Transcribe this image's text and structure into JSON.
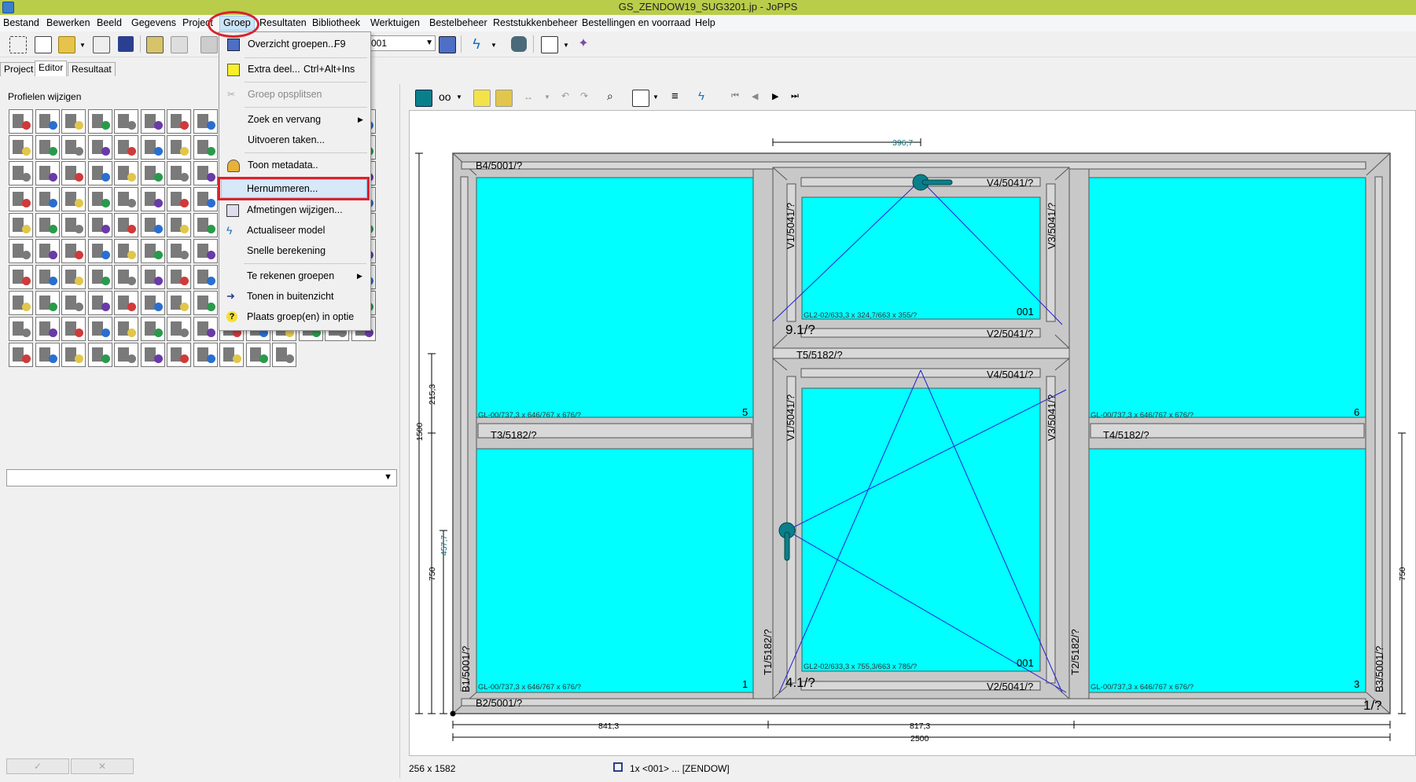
{
  "window": {
    "title": "GS_ZENDOW19_SUG3201.jp - JoPPS"
  },
  "menubar": [
    "Bestand",
    "Bewerken",
    "Beeld",
    "Gegevens",
    "Project",
    "Groep",
    "Resultaten",
    "Bibliotheek",
    "Werktuigen",
    "Bestelbeheer",
    "Reststukkenbeheer",
    "Bestellingen en voorraad",
    "Help"
  ],
  "toolbar": {
    "combo_value": "001"
  },
  "tabs": [
    "Project",
    "Editor",
    "Resultaat"
  ],
  "left_panel": {
    "title": "Profielen wijzigen"
  },
  "groep_menu": {
    "items": [
      {
        "label": "Overzicht groepen...",
        "accel": "F9",
        "icon": "list-icon"
      },
      {
        "label": "Extra deel...",
        "accel": "Ctrl+Alt+Ins",
        "icon": "yellow-square-icon"
      },
      {
        "label": "Groep opsplitsen",
        "icon": "split-icon",
        "disabled": true
      },
      {
        "label": "Zoek en vervang",
        "submenu": true
      },
      {
        "label": "Uitvoeren taken..."
      },
      {
        "label": "Toon metadata..",
        "icon": "person-icon"
      },
      {
        "label": "Hernummeren...",
        "highlighted": true
      },
      {
        "label": "Afmetingen wijzigen...",
        "icon": "resize-icon"
      },
      {
        "label": "Actualiseer model",
        "icon": "lightning-icon"
      },
      {
        "label": "Snelle berekening"
      },
      {
        "label": "Te rekenen groepen",
        "submenu": true
      },
      {
        "label": "Tonen in buitenzicht",
        "icon": "arrow-icon"
      },
      {
        "label": "Plaats groep(en) in optie",
        "icon": "question-icon"
      }
    ]
  },
  "drawing": {
    "top_dim": "396,7",
    "profiles": {
      "b4": "B4/5001/?",
      "b2": "B2/5001/?",
      "b1": "B1/5001/?",
      "b3": "B3/5001/?",
      "t3": "T3/5182/?",
      "t4": "T4/5182/?",
      "t5": "T5/5182/?",
      "t1": "T1/5182/?",
      "t2": "T2/5182/?",
      "v4_top": "V4/5041/?",
      "v2_top": "V2/5041/?",
      "v1_top": "V1/5041/?",
      "v3_top": "V3/5041/?",
      "v4_bot": "V4/5041/?",
      "v2_bot": "V2/5041/?",
      "v1_bot": "V1/5041/?",
      "v3_bot": "V3/5041/?"
    },
    "glass": {
      "upper_left": "GL-00/737,3 x 646/767 x 676/?",
      "upper_right": "GL-00/737,3 x 646/767 x 676/?",
      "lower_left": "GL-00/737,3 x 646/767 x 676/?",
      "lower_right": "GL-00/737,3 x 646/767 x 676/?",
      "sash_top": "GL2-02/633,3 x 324,7/663 x 355/?",
      "sash_bot": "GL2-02/633,3 x 755,3/663 x 785/?"
    },
    "numbers": {
      "n5": "5",
      "n6": "6",
      "n1": "1",
      "n3": "3",
      "s_top": "001",
      "s_bot": "001"
    },
    "labels": {
      "g9": "9.1/?",
      "g4": "4.1/?",
      "g1": "1/?"
    },
    "dims": {
      "h_total": "1500",
      "h_upper": "215,3",
      "h_lower": "750",
      "handle": "457,7",
      "right": "750",
      "w1": "841,3",
      "w2": "817,3",
      "w_total": "2500"
    }
  },
  "statusbar": {
    "coords": "256 x 1582",
    "info": "1x <001> ... [ZENDOW]"
  },
  "colors": {
    "glass": "#00ffff",
    "frame": "#c8c8c8",
    "highlight": "#d9232e",
    "titlebar": "#b9cd4a"
  }
}
